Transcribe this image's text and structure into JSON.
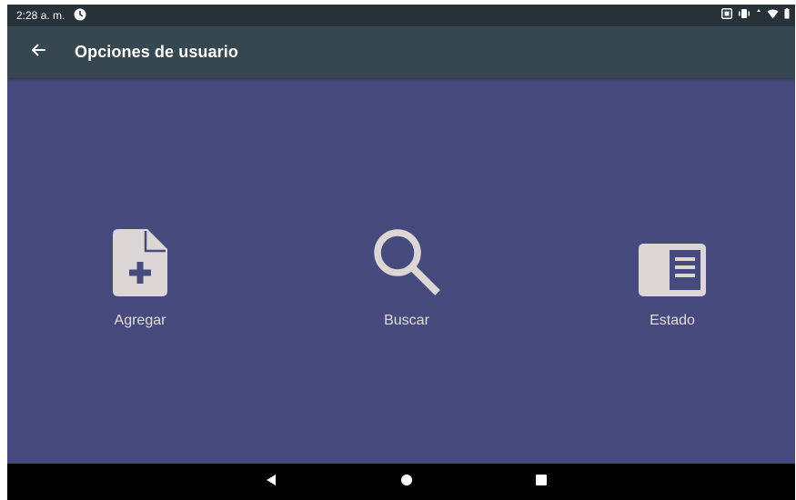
{
  "status_bar": {
    "time": "2:28 a. m."
  },
  "app_bar": {
    "title": "Opciones de usuario"
  },
  "options": [
    {
      "label": "Agregar",
      "icon": "add-document-icon"
    },
    {
      "label": "Buscar",
      "icon": "search-icon"
    },
    {
      "label": "Estado",
      "icon": "list-panel-icon"
    }
  ],
  "colors": {
    "status_bar": "#263238",
    "app_bar": "#37474f",
    "background": "#474a7c",
    "icon": "#dcd6d6",
    "nav_bar": "#000000"
  }
}
